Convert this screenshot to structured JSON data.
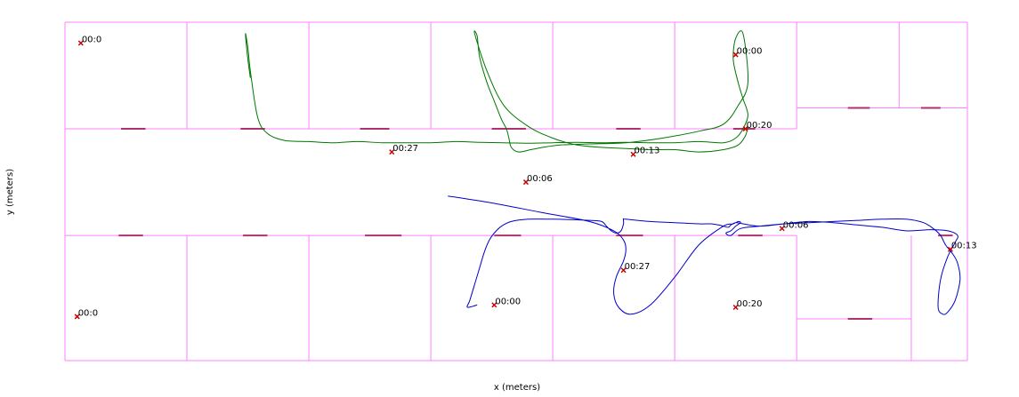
{
  "chart_data": {
    "type": "line",
    "title": "",
    "xlabel": "x (meters)",
    "ylabel": "y (meters)",
    "xlim": [
      0,
      37
    ],
    "ylim": [
      0,
      14.6
    ],
    "grid": false,
    "colors": {
      "walls": "#ff80ff",
      "doors": "#b03070",
      "markers": "#cc0000",
      "labels": "#000000"
    },
    "walls": [
      [
        [
          0,
          0
        ],
        [
          37,
          0
        ]
      ],
      [
        [
          0,
          14.6
        ],
        [
          37,
          14.6
        ]
      ],
      [
        [
          0,
          0
        ],
        [
          0,
          14.6
        ]
      ],
      [
        [
          37,
          0
        ],
        [
          37,
          14.6
        ]
      ],
      [
        [
          0,
          10
        ],
        [
          30,
          10
        ]
      ],
      [
        [
          0,
          5.4
        ],
        [
          30,
          5.4
        ]
      ],
      [
        [
          30,
          10.9
        ],
        [
          37,
          10.9
        ]
      ],
      [
        [
          30,
          1.8
        ],
        [
          34.7,
          1.8
        ]
      ],
      [
        [
          30,
          10
        ],
        [
          30,
          14.6
        ]
      ],
      [
        [
          30,
          0
        ],
        [
          30,
          5.4
        ]
      ],
      [
        [
          5,
          10
        ],
        [
          5,
          14.6
        ]
      ],
      [
        [
          10,
          10
        ],
        [
          10,
          14.6
        ]
      ],
      [
        [
          15,
          10
        ],
        [
          15,
          14.6
        ]
      ],
      [
        [
          20,
          10
        ],
        [
          20,
          14.6
        ]
      ],
      [
        [
          25,
          10
        ],
        [
          25,
          14.6
        ]
      ],
      [
        [
          34.2,
          10.9
        ],
        [
          34.2,
          14.6
        ]
      ],
      [
        [
          5,
          0
        ],
        [
          5,
          5.4
        ]
      ],
      [
        [
          10,
          0
        ],
        [
          10,
          5.4
        ]
      ],
      [
        [
          15,
          0
        ],
        [
          15,
          5.4
        ]
      ],
      [
        [
          20,
          0
        ],
        [
          20,
          5.4
        ]
      ],
      [
        [
          25,
          0
        ],
        [
          25,
          5.4
        ]
      ],
      [
        [
          34.7,
          0
        ],
        [
          34.7,
          5.4
        ]
      ]
    ],
    "doors": [
      [
        [
          2.3,
          10
        ],
        [
          3.3,
          10
        ]
      ],
      [
        [
          7.2,
          10
        ],
        [
          8.2,
          10
        ]
      ],
      [
        [
          12.1,
          10
        ],
        [
          13.3,
          10
        ]
      ],
      [
        [
          17.5,
          10
        ],
        [
          18.9,
          10
        ]
      ],
      [
        [
          22.6,
          10
        ],
        [
          23.6,
          10
        ]
      ],
      [
        [
          27.4,
          10
        ],
        [
          28.3,
          10
        ]
      ],
      [
        [
          32.1,
          10.9
        ],
        [
          33,
          10.9
        ]
      ],
      [
        [
          35.1,
          10.9
        ],
        [
          35.9,
          10.9
        ]
      ],
      [
        [
          2.2,
          5.4
        ],
        [
          3.2,
          5.4
        ]
      ],
      [
        [
          7.3,
          5.4
        ],
        [
          8.3,
          5.4
        ]
      ],
      [
        [
          12.3,
          5.4
        ],
        [
          13.8,
          5.4
        ]
      ],
      [
        [
          17.6,
          5.4
        ],
        [
          18.7,
          5.4
        ]
      ],
      [
        [
          22.6,
          5.4
        ],
        [
          23.7,
          5.4
        ]
      ],
      [
        [
          27.6,
          5.4
        ],
        [
          28.6,
          5.4
        ]
      ],
      [
        [
          32.1,
          1.8
        ],
        [
          33.1,
          1.8
        ]
      ],
      [
        [
          35.8,
          5.4
        ],
        [
          36.4,
          5.4
        ]
      ]
    ],
    "series": [
      {
        "color": "#007700",
        "x": [
          7.6,
          7.5,
          7.4,
          7.5,
          7.6,
          7.9,
          8.3,
          9,
          10,
          11,
          12,
          13,
          14,
          15,
          16,
          17,
          18,
          19,
          20,
          21,
          22,
          23,
          24,
          25,
          26,
          27,
          27.5,
          27.8,
          28,
          27.8,
          27.6,
          27.4,
          27.5,
          27.8,
          28,
          27.6,
          27,
          26,
          24.5,
          23,
          21.5,
          20.3,
          19.6,
          19.1,
          18.6,
          18.3,
          18.2,
          18.1,
          17.9,
          17.6,
          17.3,
          17,
          16.9,
          16.8,
          17.3,
          18,
          19,
          20,
          21,
          22,
          23,
          24,
          25,
          26,
          27,
          27.6,
          27.9,
          28
        ],
        "y": [
          12.2,
          13,
          14.1,
          13.5,
          12.5,
          10.5,
          9.8,
          9.5,
          9.45,
          9.4,
          9.45,
          9.4,
          9.4,
          9.4,
          9.45,
          9.42,
          9.4,
          9.38,
          9.4,
          9.42,
          9.4,
          9.42,
          9.4,
          9.4,
          9.45,
          9.4,
          9.6,
          10,
          10.6,
          11.3,
          12,
          13,
          13.9,
          14.1,
          12,
          11,
          10.2,
          9.9,
          9.6,
          9.4,
          9.35,
          9.3,
          9.2,
          9.1,
          9,
          9.2,
          9.6,
          10,
          10.4,
          11.2,
          12,
          13.1,
          14,
          14.1,
          12.5,
          11,
          10.1,
          9.6,
          9.3,
          9.2,
          9.15,
          9.1,
          9.1,
          9.0,
          9.1,
          9.3,
          9.7,
          10.1
        ]
      },
      {
        "color": "#0000cc",
        "x": [
          15.7,
          17.5,
          19.5,
          21.5,
          22.5,
          22.9,
          23,
          22.9,
          22.6,
          22.5,
          22.7,
          23.2,
          24,
          25,
          26,
          27,
          27.4,
          27.6,
          27.7,
          27.5,
          27.3,
          27.1,
          27.3,
          27.7,
          28.5,
          29.5,
          30.5,
          31.5,
          32.5,
          33.5,
          34.5,
          35.2,
          35.6,
          35.9,
          36.1,
          36.4,
          36.6,
          36.7,
          36.5,
          36.2,
          36,
          35.8,
          35.9,
          36.2,
          36.5,
          36.6,
          36.2,
          35.5,
          34.5,
          33.5,
          32.5,
          31.5,
          30.5,
          29.5,
          28.5,
          27.8,
          27.5,
          27.3,
          27.2,
          27,
          26.8,
          26.5,
          26,
          25,
          24,
          23,
          22.9,
          22.9,
          22.8,
          22.6,
          22.4,
          22.2,
          22,
          21.5,
          20,
          19,
          18.3,
          17.9,
          17.6,
          17.4,
          17.2,
          17,
          16.8,
          16.6,
          16.5,
          16.9
        ],
        "y": [
          7.1,
          6.8,
          6.4,
          6.0,
          5.6,
          5.2,
          4.8,
          4.3,
          3.6,
          2.9,
          2.3,
          2.0,
          2.4,
          3.6,
          5.0,
          5.8,
          5.9,
          6.0,
          5.95,
          5.8,
          5.6,
          5.5,
          5.4,
          5.7,
          5.8,
          5.9,
          5.95,
          6.0,
          6.05,
          6.1,
          6.1,
          5.95,
          5.7,
          5.4,
          5.0,
          4.6,
          4.2,
          3.5,
          2.6,
          2.1,
          2.0,
          2.3,
          3.5,
          4.5,
          5.1,
          5.4,
          5.6,
          5.65,
          5.6,
          5.75,
          5.85,
          5.95,
          6.0,
          5.9,
          5.8,
          5.9,
          5.95,
          5.85,
          5.75,
          5.8,
          5.85,
          5.9,
          5.9,
          5.95,
          6.0,
          6.1,
          6.1,
          5.9,
          5.6,
          5.5,
          5.6,
          5.8,
          6.0,
          6.05,
          6.1,
          6.1,
          6.0,
          5.8,
          5.5,
          5.2,
          4.7,
          4.0,
          3.3,
          2.6,
          2.3,
          2.4
        ]
      }
    ],
    "markers": [
      {
        "label": "00:00",
        "x": 27.5,
        "y": 13.2
      },
      {
        "label": "00:06",
        "x": 18.9,
        "y": 7.7
      },
      {
        "label": "00:13",
        "x": 23.3,
        "y": 8.9
      },
      {
        "label": "00:20",
        "x": 27.9,
        "y": 10.0
      },
      {
        "label": "00:27",
        "x": 13.4,
        "y": 9.0
      },
      {
        "label": "00:0",
        "x": 0.65,
        "y": 13.7
      },
      {
        "label": "00:0",
        "x": 0.5,
        "y": 1.9
      },
      {
        "label": "00:00",
        "x": 17.6,
        "y": 2.4
      },
      {
        "label": "00:06",
        "x": 29.4,
        "y": 5.7
      },
      {
        "label": "00:13",
        "x": 36.3,
        "y": 4.8
      },
      {
        "label": "00:20",
        "x": 27.5,
        "y": 2.3
      },
      {
        "label": "00:27",
        "x": 22.9,
        "y": 3.9
      }
    ]
  }
}
